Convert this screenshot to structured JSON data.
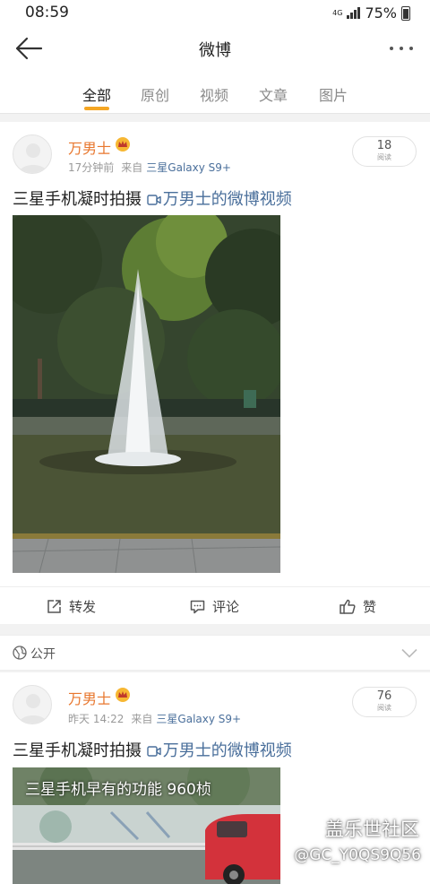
{
  "status_bar": {
    "time": "08:59",
    "network": "4G",
    "battery": "75%"
  },
  "header": {
    "title": "微博"
  },
  "tabs": [
    {
      "label": "全部",
      "active": true
    },
    {
      "label": "原创",
      "active": false
    },
    {
      "label": "视频",
      "active": false
    },
    {
      "label": "文章",
      "active": false
    },
    {
      "label": "图片",
      "active": false
    }
  ],
  "posts": [
    {
      "username": "万男士",
      "time": "17分钟前",
      "source_prefix": "来自",
      "source": "三星Galaxy S9+",
      "reads": "18",
      "reads_label": "阅读",
      "text": "三星手机凝时拍摄",
      "link": "万男士的微博视频"
    },
    {
      "username": "万男士",
      "time": "昨天 14:22",
      "source_prefix": "来自",
      "source": "三星Galaxy S9+",
      "reads": "76",
      "reads_label": "阅读",
      "text": "三星手机凝时拍摄",
      "link": "万男士的微博视频",
      "thumb_caption": "三星手机早有的功能 960桢"
    }
  ],
  "actions": {
    "repost": "转发",
    "comment": "评论",
    "like": "赞"
  },
  "visibility": {
    "label": "公开"
  },
  "watermark": {
    "line1": "盖乐世社区",
    "line2": "@GC_Y0QS9Q56"
  },
  "colors": {
    "accent": "#f5a623",
    "username": "#e8772e",
    "link": "#4a6f9b"
  }
}
